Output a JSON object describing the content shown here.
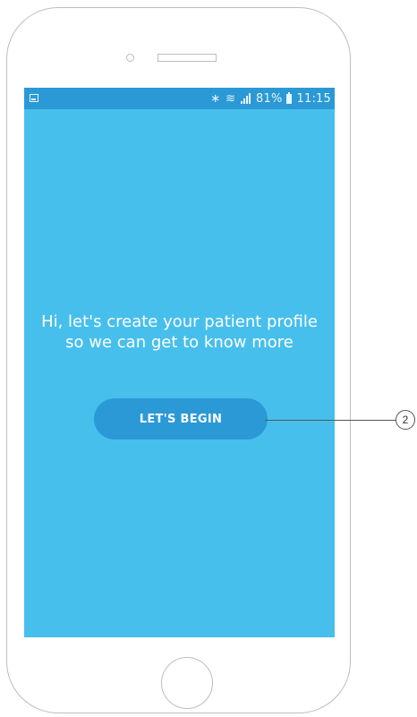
{
  "status_bar": {
    "left_icon": "gallery-icon",
    "bluetooth_glyph": "∗",
    "wifi_glyph": "≋",
    "battery_percent": "81%",
    "time": "11:15",
    "color": "#2b99d6"
  },
  "screen": {
    "background": "#47bfec",
    "headline_line1": "Hi, let's create your patient profile",
    "headline_line2": "so we can get to know more",
    "begin_button_label": "LET'S BEGIN"
  },
  "annotation": {
    "callout_number": "2"
  }
}
